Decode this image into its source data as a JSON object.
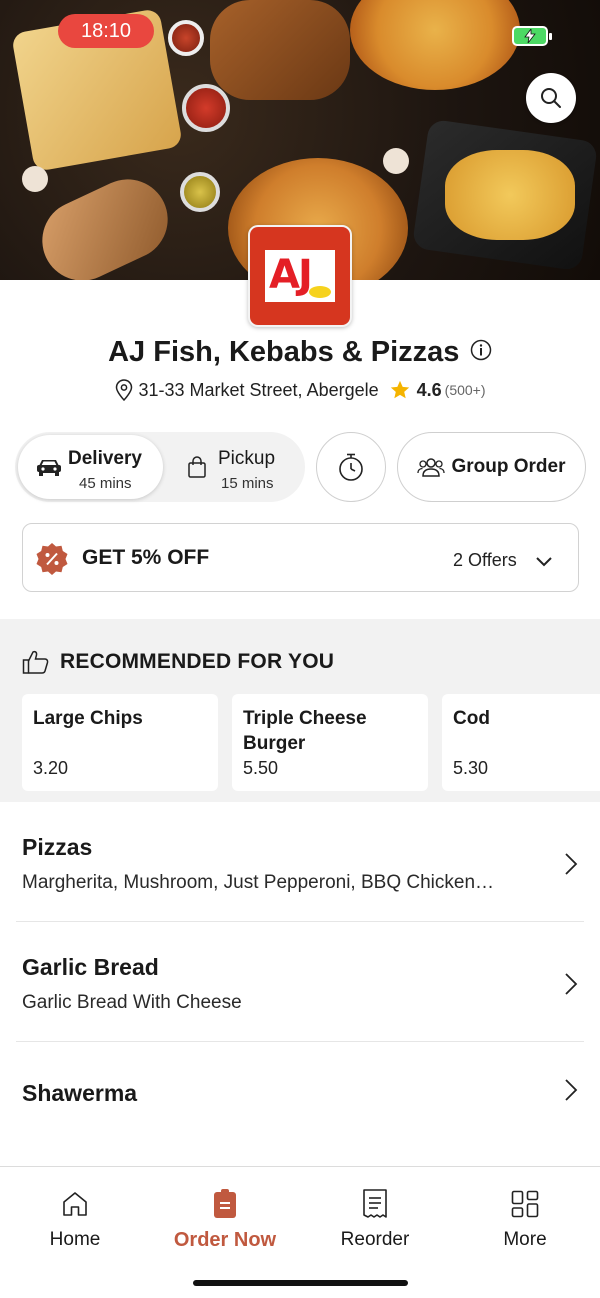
{
  "status_bar": {
    "time": "18:10"
  },
  "restaurant": {
    "logo_text": "AJ",
    "name": "AJ Fish, Kebabs & Pizzas",
    "address": "31-33 Market Street, Abergele",
    "rating": "4.6",
    "rating_count": "(500+)"
  },
  "order_mode": {
    "delivery": {
      "label": "Delivery",
      "time": "45 mins"
    },
    "pickup": {
      "label": "Pickup",
      "time": "15 mins"
    },
    "group_order_label": "Group Order"
  },
  "offer": {
    "title": "GET 5% OFF",
    "count_label": "2 Offers"
  },
  "recommended": {
    "heading": "RECOMMENDED FOR YOU",
    "items": [
      {
        "name": "Large Chips",
        "price": "3.20"
      },
      {
        "name": "Triple Cheese Burger",
        "price": "5.50"
      },
      {
        "name": "Cod",
        "price": "5.30"
      }
    ]
  },
  "categories": [
    {
      "name": "Pizzas",
      "description": "Margherita, Mushroom, Just Pepperoni, BBQ Chicken…"
    },
    {
      "name": "Garlic Bread",
      "description": "Garlic Bread With Cheese"
    },
    {
      "name": "Shawerma",
      "description": ""
    }
  ],
  "bottom_nav": {
    "items": [
      {
        "label": "Home",
        "icon": "home-icon"
      },
      {
        "label": "Order Now",
        "icon": "order-bag-icon"
      },
      {
        "label": "Reorder",
        "icon": "receipt-icon"
      },
      {
        "label": "More",
        "icon": "grid-icon"
      }
    ],
    "active": "Order Now"
  },
  "colors": {
    "accent": "#c0593f",
    "time_pill": "#e9473f",
    "battery": "#4cd964",
    "logo_bg": "#d6361f",
    "star": "#f5b400"
  }
}
